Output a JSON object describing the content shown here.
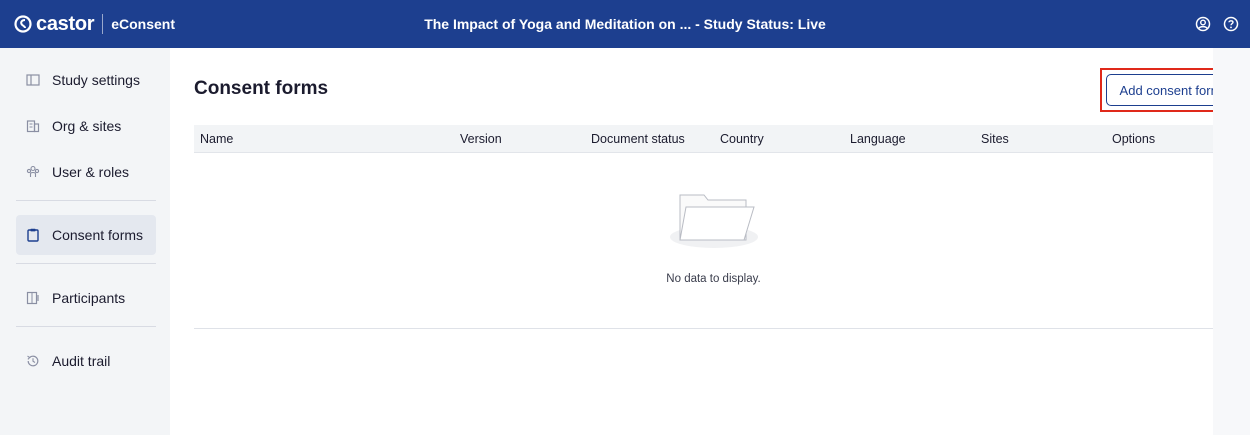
{
  "topbar": {
    "brand": "castor",
    "product": "eConsent",
    "title": "The Impact of Yoga and Meditation on ...  - Study Status: Live",
    "icons": [
      "user-circle-icon",
      "help-icon"
    ]
  },
  "sidebar": {
    "items": [
      {
        "label": "Study settings",
        "icon": "settings-panel-icon",
        "active": false
      },
      {
        "label": "Org & sites",
        "icon": "building-icon",
        "active": false
      },
      {
        "label": "User & roles",
        "icon": "users-icon",
        "active": false
      },
      {
        "label": "Consent forms",
        "icon": "clipboard-icon",
        "active": true
      },
      {
        "label": "Participants",
        "icon": "participants-icon",
        "active": false
      },
      {
        "label": "Audit trail",
        "icon": "history-icon",
        "active": false
      }
    ]
  },
  "main": {
    "title": "Consent forms",
    "add_button": "Add consent form",
    "table": {
      "columns": [
        "Name",
        "Version",
        "Document status",
        "Country",
        "Language",
        "Sites",
        "Options"
      ],
      "rows": [],
      "empty_text": "No data to display."
    }
  },
  "colors": {
    "topbar": "#1d3f8f",
    "accent": "#1d3f8f",
    "highlight": "#e0291a"
  }
}
